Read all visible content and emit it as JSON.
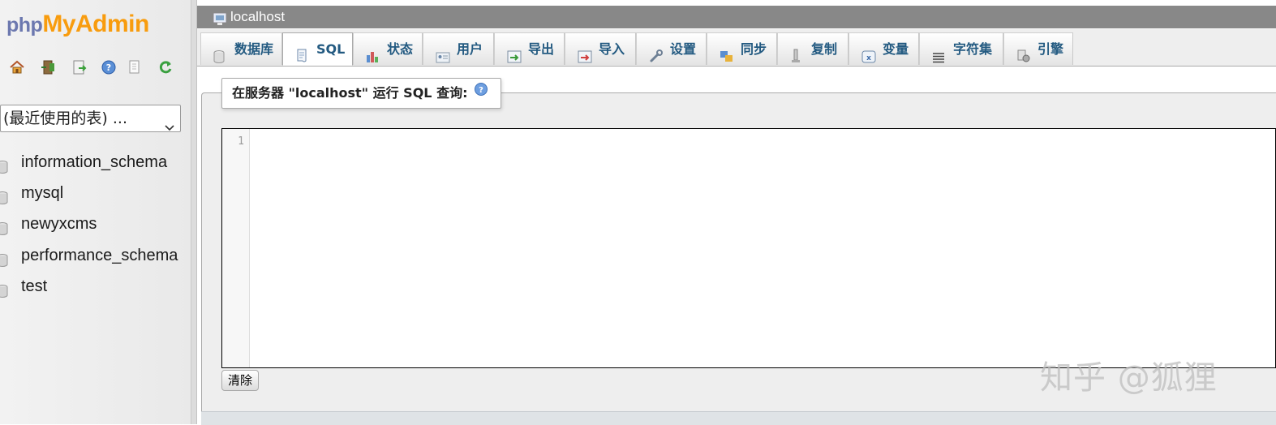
{
  "logo": {
    "php": "php",
    "my": "My",
    "admin": "Admin"
  },
  "nav_icons": [
    "home-icon",
    "logout-icon",
    "sql-query-icon",
    "docs-icon",
    "copy-icon",
    "reload-icon"
  ],
  "db_select": {
    "value": "(最近使用的表) ..."
  },
  "databases": [
    "information_schema",
    "mysql",
    "newyxcms",
    "performance_schema",
    "test"
  ],
  "breadcrumb": {
    "server": "localhost"
  },
  "tabs": [
    {
      "label": "数据库",
      "icon": "database-icon"
    },
    {
      "label": "SQL",
      "icon": "sql-icon",
      "active": true
    },
    {
      "label": "状态",
      "icon": "status-icon"
    },
    {
      "label": "用户",
      "icon": "users-icon"
    },
    {
      "label": "导出",
      "icon": "export-icon"
    },
    {
      "label": "导入",
      "icon": "import-icon"
    },
    {
      "label": "设置",
      "icon": "wrench-icon"
    },
    {
      "label": "同步",
      "icon": "sync-icon"
    },
    {
      "label": "复制",
      "icon": "replication-icon"
    },
    {
      "label": "变量",
      "icon": "variables-icon"
    },
    {
      "label": "字符集",
      "icon": "charset-icon"
    },
    {
      "label": "引擎",
      "icon": "engine-icon"
    }
  ],
  "query_panel": {
    "legend": "在服务器 \"localhost\" 运行 SQL 查询:",
    "line_number": "1",
    "query_text": "",
    "clear_label": "清除"
  },
  "watermark": "知乎 @狐狸",
  "colors": {
    "accent_orange": "#f89c0e",
    "accent_blue": "#6c78af",
    "tab_text": "#235a81",
    "topbar": "#888888"
  }
}
